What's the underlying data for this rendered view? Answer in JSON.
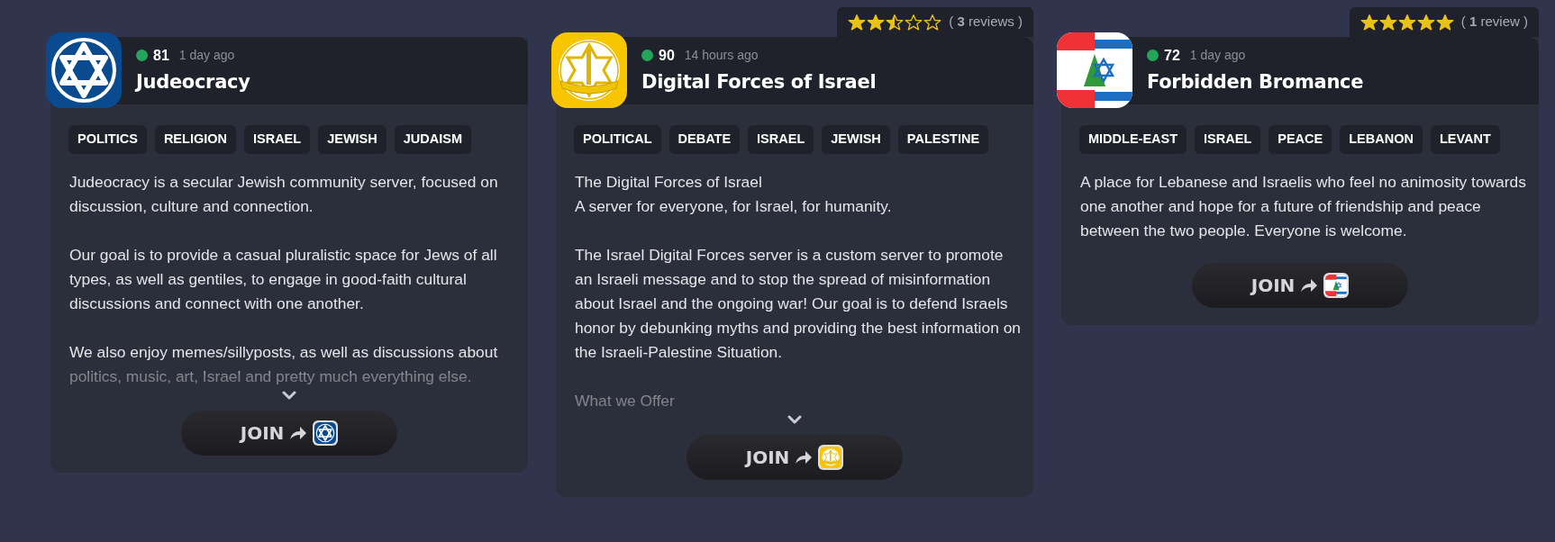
{
  "servers": [
    {
      "kind": "star",
      "members": "81",
      "time": "1 day ago",
      "name": "Judeocracy",
      "tags": [
        "POLITICS",
        "RELIGION",
        "ISRAEL",
        "JEWISH",
        "JUDAISM"
      ],
      "description": [
        "Judeocracy is a secular Jewish community server, focused on discussion, culture and connection.",
        "Our goal is to provide a casual pluralistic space for Jews of all types, as well as gentiles, to engage in good-faith cultural discussions and connect with one another.",
        "We also enjoy memes/sillyposts, as well as discussions about politics, music, art, Israel and pretty much everything else."
      ],
      "collapsed": true,
      "join": "JOIN"
    },
    {
      "kind": "emblem",
      "stars": 2.5,
      "reviews": "( **3** reviews )",
      "members": "90",
      "time": "14 hours ago",
      "name": "Digital Forces of Israel",
      "tags": [
        "POLITICAL",
        "DEBATE",
        "ISRAEL",
        "JEWISH",
        "PALESTINE"
      ],
      "description": [
        "The Digital Forces of Israel\nA server for everyone, for Israel, for humanity.",
        "The Israel Digital Forces server is a custom server to promote an Israeli message and to stop the spread of misinformation about Israel and the ongoing war! Our goal is to defend Israels honor by debunking myths and providing the best information on the Israeli-Palestine Situation.",
        "What we Offer"
      ],
      "collapsed": true,
      "join": "JOIN"
    },
    {
      "kind": "flag",
      "stars": 5,
      "reviews": "( **1** review )",
      "members": "72",
      "time": "1 day ago",
      "name": "Forbidden Bromance",
      "tags": [
        "MIDDLE-EAST",
        "ISRAEL",
        "PEACE",
        "LEBANON",
        "LEVANT"
      ],
      "description": [
        "A place for Lebanese and Israelis who feel no animosity towards one another and hope for a future of friendship and peace between the two people. Everyone is welcome."
      ],
      "collapsed": false,
      "join": "JOIN"
    }
  ]
}
